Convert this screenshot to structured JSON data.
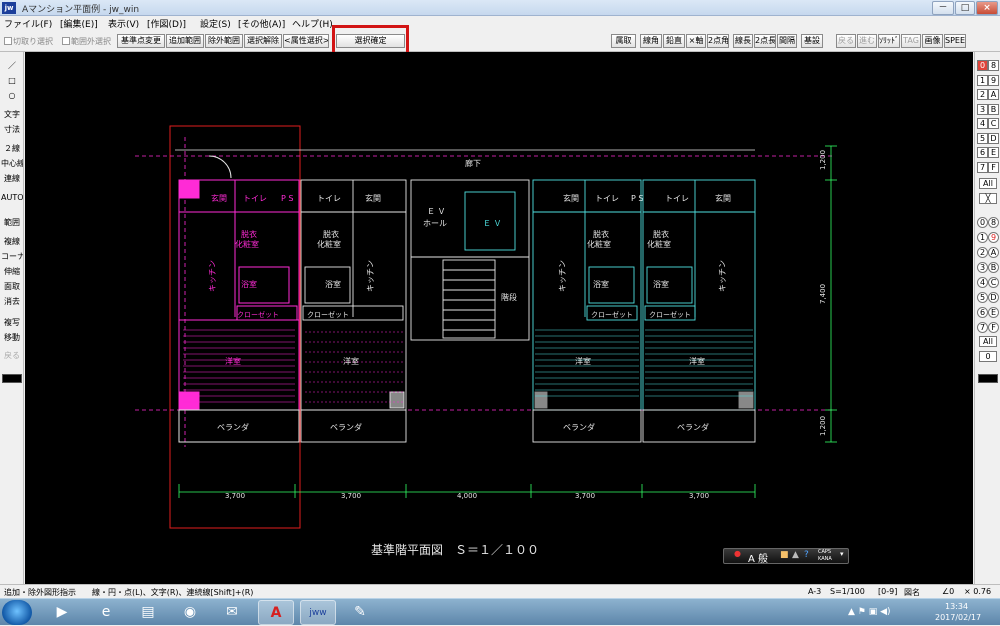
{
  "window": {
    "app_icon": "jw",
    "title": "Aマンション平面例 - jw_win",
    "minimize": "－",
    "maximize": "□",
    "close": "×"
  },
  "menu": [
    "ファイル(F)",
    "[編集(E)]",
    "表示(V)",
    "[作図(D)]",
    "設定(S)",
    "[その他(A)]",
    "ヘルプ(H)"
  ],
  "toolbar": {
    "check_cut": "切取り選択",
    "check_outside": "範囲外選択",
    "buttons_left": [
      "基準点変更",
      "追加範囲",
      "除外範囲",
      "選択解除",
      "<属性選択>"
    ],
    "confirm": "選択確定",
    "buttons_right": [
      "属取",
      "線角",
      "鉛直",
      "×軸",
      "2点角",
      "線長",
      "2点長",
      "間隔",
      "基設"
    ],
    "buttons_far_disabled": [
      "戻る",
      "進む",
      "ｿﾘｯﾄﾞ",
      "TAG"
    ],
    "buttons_far": [
      "画像",
      "SPEED"
    ]
  },
  "left_tools": [
    {
      "label": "／",
      "enabled": true
    },
    {
      "label": "□",
      "enabled": true
    },
    {
      "label": "○",
      "enabled": true
    },
    {
      "label": "文字",
      "enabled": true
    },
    {
      "label": "寸法",
      "enabled": true
    },
    {
      "label": "２線",
      "enabled": true
    },
    {
      "label": "中心線",
      "enabled": true
    },
    {
      "label": "連線",
      "enabled": true
    },
    {
      "label": "AUTO",
      "enabled": true
    },
    {
      "label": "範囲",
      "enabled": true
    },
    {
      "label": "複線",
      "enabled": true
    },
    {
      "label": "コーナー",
      "enabled": true
    },
    {
      "label": "伸縮",
      "enabled": true
    },
    {
      "label": "面取",
      "enabled": true
    },
    {
      "label": "消去",
      "enabled": true
    },
    {
      "label": "複写",
      "enabled": true
    },
    {
      "label": "移動",
      "enabled": true
    },
    {
      "label": "戻る",
      "enabled": false
    }
  ],
  "layer_panel": {
    "group_rows": [
      [
        "0",
        "8"
      ],
      [
        "1",
        "9"
      ],
      [
        "2",
        "A"
      ],
      [
        "3",
        "B"
      ],
      [
        "4",
        "C"
      ],
      [
        "5",
        "D"
      ],
      [
        "6",
        "E"
      ],
      [
        "7",
        "F"
      ]
    ],
    "all": "All",
    "cross": "╳",
    "layer_rows": [
      [
        "0",
        "8"
      ],
      [
        "1",
        "9"
      ],
      [
        "2",
        "A"
      ],
      [
        "3",
        "B"
      ],
      [
        "4",
        "C"
      ],
      [
        "5",
        "D"
      ],
      [
        "6",
        "E"
      ],
      [
        "7",
        "F"
      ]
    ],
    "all2": "All",
    "zero": "0"
  },
  "drawing": {
    "corridor": "廊下",
    "ps": "P S",
    "entrance": "玄関",
    "toilet": "トイレ",
    "dressing_1": "脱衣",
    "dressing_2": "化粧室",
    "kitchen": "キッチン",
    "bath": "浴室",
    "closet": "クローゼット",
    "western_room": "洋室",
    "veranda": "ベランダ",
    "ev_hall_1": "Ｅ Ｖ",
    "ev_hall_2": "ホール",
    "ev": "Ｅ Ｖ",
    "stairs": "階段",
    "dims_bottom": [
      "3,700",
      "3,700",
      "4,000",
      "3,700",
      "3,700"
    ],
    "dims_right": [
      "1,200",
      "7,400",
      "1,200"
    ],
    "title": "基準階平面図　Ｓ＝１／１００"
  },
  "colors": {
    "magenta": "#ff2bd6",
    "cyan": "#4fe0e0",
    "white": "#e6e6e6",
    "green": "#33ff66",
    "selection": "#e01e1e"
  },
  "ime": {
    "label": "A 般",
    "caps": "CAPS",
    "kana": "KANA"
  },
  "status": {
    "hint": "追加・除外図形指示　　線・円・点(L)、文字(R)、連続線[Shift]+(R)",
    "layer": "A-3",
    "scale": "S=1/100",
    "range": "[0-9]",
    "name": "図名",
    "angle": "∠0",
    "zoom": "× 0.76"
  },
  "taskbar": {
    "time": "13:34",
    "date": "2017/02/17"
  }
}
